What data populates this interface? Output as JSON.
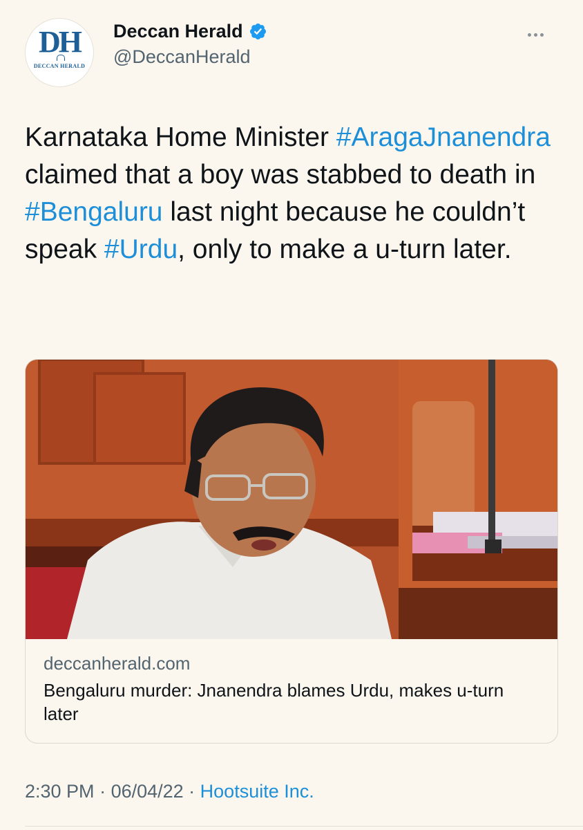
{
  "account": {
    "logo_text": "DH",
    "logo_subtext": "DECCAN HERALD",
    "display_name": "Deccan Herald",
    "handle": "@DeccanHerald",
    "verified": true
  },
  "tweet": {
    "text_parts": [
      {
        "t": "Karnataka Home Minister "
      },
      {
        "t": "#AragaJnanendra",
        "hashtag": true
      },
      {
        "t": " claimed that a boy was stabbed to death in "
      },
      {
        "t": "#Bengaluru",
        "hashtag": true
      },
      {
        "t": " last night because he couldn’t speak "
      },
      {
        "t": "#Urdu",
        "hashtag": true
      },
      {
        "t": ", only to make a u-turn later."
      }
    ]
  },
  "link_card": {
    "domain": "deccanherald.com",
    "title": "Bengaluru murder: Jnanendra blames Urdu, makes u-turn later"
  },
  "meta": {
    "time": "2:30 PM",
    "separator": " · ",
    "date": "06/04/22",
    "source": "Hootsuite Inc."
  },
  "icons": {
    "verified": "verified-badge-icon",
    "more": "more-options-icon"
  },
  "colors": {
    "background": "#fbf7ee",
    "hashtag": "#1d8fd8",
    "secondary_text": "#536471",
    "brand": "#1d5f96",
    "verified": "#1d9bf0"
  }
}
